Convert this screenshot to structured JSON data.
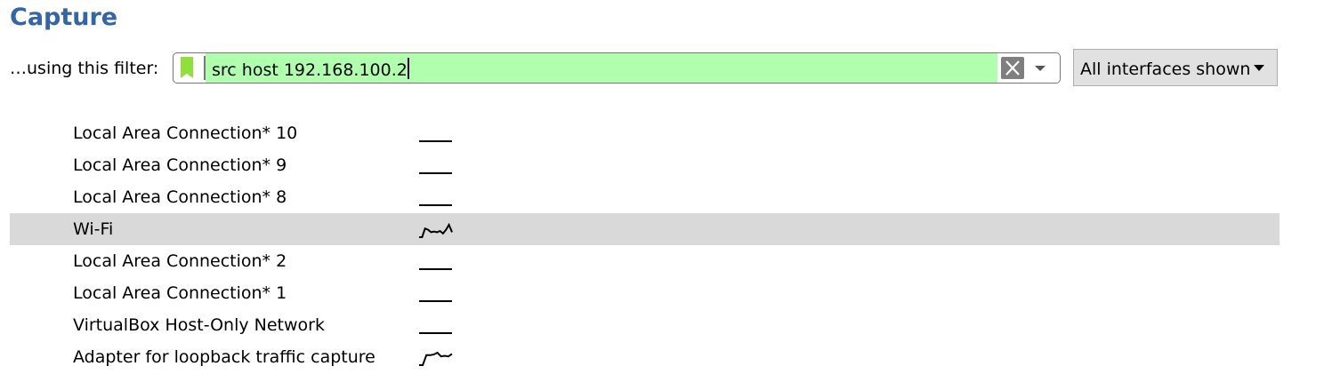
{
  "title": "Capture",
  "filter": {
    "label": "…using this filter:",
    "value": "src host 192.168.100.2",
    "valid_color": "#afffaf",
    "icons": [
      "bookmark-icon",
      "clear-icon",
      "chevron-down-icon"
    ]
  },
  "interfaces_button": {
    "label": "All interfaces shown"
  },
  "interfaces": [
    {
      "name": "Local Area Connection* 10",
      "traffic": [
        0,
        0,
        0,
        0,
        0,
        0,
        0,
        0,
        0,
        0
      ]
    },
    {
      "name": "Local Area Connection* 9",
      "traffic": [
        0,
        0,
        0,
        0,
        0,
        0,
        0,
        0,
        0,
        0
      ]
    },
    {
      "name": "Local Area Connection* 8",
      "traffic": [
        0,
        0,
        0,
        0,
        0,
        0,
        0,
        0,
        0,
        0
      ]
    },
    {
      "name": "Wi-Fi",
      "traffic": [
        0,
        0,
        0.7,
        0.6,
        0.4,
        0.45,
        0.4,
        0.5,
        0.3,
        0.6,
        1,
        0.4
      ],
      "selected": true
    },
    {
      "name": "Local Area Connection* 2",
      "traffic": [
        0,
        0,
        0,
        0,
        0,
        0,
        0,
        0,
        0,
        0
      ]
    },
    {
      "name": "Local Area Connection* 1",
      "traffic": [
        0,
        0,
        0,
        0,
        0,
        0,
        0,
        0,
        0,
        0
      ]
    },
    {
      "name": "VirtualBox Host-Only Network",
      "traffic": [
        0,
        0,
        0,
        0,
        0,
        0,
        0,
        0,
        0,
        0
      ]
    },
    {
      "name": "Adapter for loopback traffic capture",
      "traffic": [
        0,
        0,
        0.8,
        0.8,
        0.85,
        1,
        0.7,
        0.75,
        0.7,
        0.9
      ]
    }
  ]
}
